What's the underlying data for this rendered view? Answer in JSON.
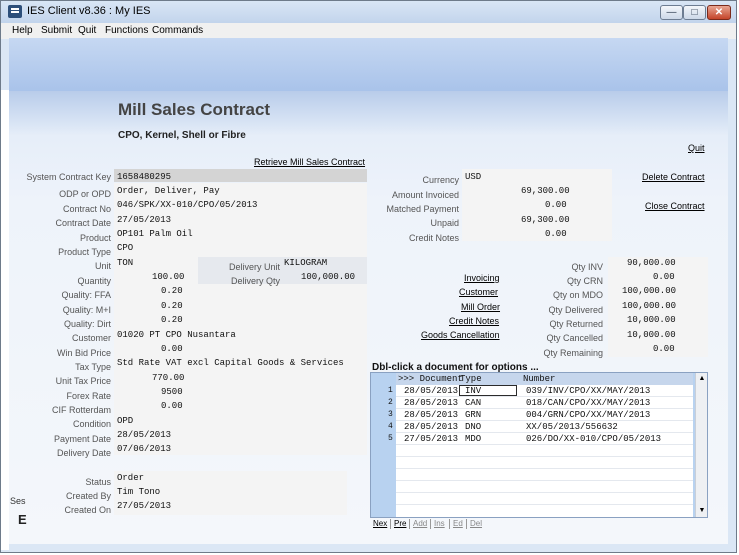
{
  "window": {
    "title": "IES Client v8.36 : My IES"
  },
  "menu": [
    "Help",
    "Submit",
    "Quit",
    "Functions",
    "Commands"
  ],
  "page": {
    "title": "Mill Sales Contract",
    "subtitle": "CPO, Kernel, Shell or Fibre",
    "links": {
      "quit": "Quit",
      "retrieve": "Retrieve Mill Sales Contract",
      "delete": "Delete Contract",
      "close": "Close Contract"
    }
  },
  "left_fields": {
    "system_contract_key": {
      "label": "System Contract Key",
      "value": "1658480295"
    },
    "odp_or_opd": {
      "label": "ODP or OPD",
      "value": "Order, Deliver, Pay"
    },
    "contract_no": {
      "label": "Contract No",
      "value": "046/SPK/XX-010/CPO/05/2013"
    },
    "contract_date": {
      "label": "Contract Date",
      "value": "27/05/2013"
    },
    "product": {
      "label": "Product",
      "value": "OP101 Palm Oil"
    },
    "product_type": {
      "label": "Product Type",
      "value": "CPO"
    },
    "unit": {
      "label": "Unit",
      "value": "TON"
    },
    "delivery_unit": {
      "label": "Delivery Unit",
      "value": "KILOGRAM"
    },
    "quantity": {
      "label": "Quantity",
      "value": "100.00"
    },
    "delivery_qty": {
      "label": "Delivery Qty",
      "value": "100,000.00"
    },
    "quality_ffa": {
      "label": "Quality: FFA",
      "value": "0.20"
    },
    "quality_mi": {
      "label": "Quality: M+I",
      "value": "0.20"
    },
    "quality_dirt": {
      "label": "Quality: Dirt",
      "value": "0.20"
    },
    "customer": {
      "label": "Customer",
      "value": "01020 PT CPO Nusantara"
    },
    "win_bid_price": {
      "label": "Win Bid Price",
      "value": "0.00"
    },
    "tax_type": {
      "label": "Tax Type",
      "value": "Std Rate VAT excl Capital Goods & Services"
    },
    "unit_tax_price": {
      "label": "Unit Tax Price",
      "value": "770.00"
    },
    "forex_rate": {
      "label": "Forex Rate",
      "value": "9500"
    },
    "cif_rotterdam": {
      "label": "CIF Rotterdam",
      "value": "0.00"
    },
    "condition": {
      "label": "Condition",
      "value": "OPD"
    },
    "payment_date": {
      "label": "Payment Date",
      "value": "28/05/2013"
    },
    "delivery_date": {
      "label": "Delivery Date",
      "value": "07/06/2013"
    },
    "status": {
      "label": "Status",
      "value": "Order"
    },
    "created_by": {
      "label": "Created By",
      "value": "Tim Tono"
    },
    "created_on": {
      "label": "Created On",
      "value": "27/05/2013"
    }
  },
  "financials": {
    "currency": {
      "label": "Currency",
      "value": "USD"
    },
    "amount_invoiced": {
      "label": "Amount Invoiced",
      "value": "69,300.00"
    },
    "matched_payment": {
      "label": "Matched Payment",
      "value": "0.00"
    },
    "unpaid": {
      "label": "Unpaid",
      "value": "69,300.00"
    },
    "credit_notes": {
      "label": "Credit Notes",
      "value": "0.00"
    }
  },
  "doc_links": [
    "Invoicing",
    "Customer",
    "Mill Order",
    "Credit Notes",
    "Goods Cancellation"
  ],
  "quantities": {
    "qty_inv": {
      "label": "Qty INV",
      "value": "90,000.00"
    },
    "qty_crn": {
      "label": "Qty CRN",
      "value": "0.00"
    },
    "qty_on_mdo": {
      "label": "Qty on MDO",
      "value": "100,000.00"
    },
    "qty_delivered": {
      "label": "Qty Delivered",
      "value": "100,000.00"
    },
    "qty_returned": {
      "label": "Qty Returned",
      "value": "10,000.00"
    },
    "qty_cancelled": {
      "label": "Qty Cancelled",
      "value": "10,000.00"
    },
    "qty_remaining": {
      "label": "Qty Remaining",
      "value": "0.00"
    }
  },
  "documents": {
    "heading": "Dbl-click a document for options ...",
    "columns": {
      "document": ">>> Document",
      "type": "Type",
      "number": "Number"
    },
    "rows": [
      {
        "n": "1",
        "date": "28/05/2013",
        "type": "INV",
        "number": "039/INV/CPO/XX/MAY/2013"
      },
      {
        "n": "2",
        "date": "28/05/2013",
        "type": "CAN",
        "number": "018/CAN/CPO/XX/MAY/2013"
      },
      {
        "n": "3",
        "date": "28/05/2013",
        "type": "GRN",
        "number": "004/GRN/CPO/XX/MAY/2013"
      },
      {
        "n": "4",
        "date": "28/05/2013",
        "type": "DNO",
        "number": "XX/05/2013/556632"
      },
      {
        "n": "5",
        "date": "27/05/2013",
        "type": "MDO",
        "number": "026/DO/XX-010/CPO/05/2013"
      }
    ],
    "buttons": [
      "Nex",
      "Pre",
      "Add",
      "Ins",
      "Ed",
      "Del"
    ]
  },
  "side_stub": {
    "label": "Ses",
    "letter": "E"
  }
}
